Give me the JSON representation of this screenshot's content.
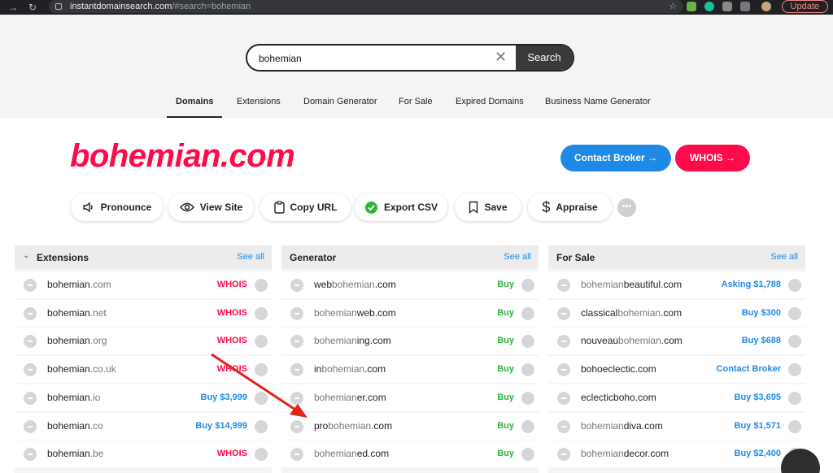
{
  "browser": {
    "url_host": "instantdomainsearch.com",
    "url_path": "/#search=bohemian",
    "update_label": "Update"
  },
  "search": {
    "value": "bohemian",
    "button_label": "Search"
  },
  "tabs": [
    {
      "label": "Domains",
      "active": true
    },
    {
      "label": "Extensions"
    },
    {
      "label": "Domain Generator"
    },
    {
      "label": "For Sale"
    },
    {
      "label": "Expired Domains"
    },
    {
      "label": "Business Name Generator"
    }
  ],
  "domain_title": "bohemian.com",
  "buttons": {
    "contact_broker": "Contact Broker →",
    "whois": "WHOIS →"
  },
  "actions": [
    {
      "label": "Pronounce",
      "icon": "speaker-icon"
    },
    {
      "label": "View Site",
      "icon": "eye-icon"
    },
    {
      "label": "Copy URL",
      "icon": "clipboard-icon"
    },
    {
      "label": "Export CSV",
      "icon": "check-badge-icon"
    },
    {
      "label": "Save",
      "icon": "bookmark-icon"
    },
    {
      "label": "Appraise",
      "icon": "dollar-icon"
    }
  ],
  "see_all_label": "See all",
  "panels": {
    "extensions": {
      "title": "Extensions",
      "rows": [
        {
          "name": "bohemian",
          "ext": ".com",
          "action": "WHOIS"
        },
        {
          "name": "bohemian",
          "ext": ".net",
          "action": "WHOIS"
        },
        {
          "name": "bohemian",
          "ext": ".org",
          "action": "WHOIS"
        },
        {
          "name": "bohemian",
          "ext": ".co.uk",
          "action": "WHOIS"
        },
        {
          "name": "bohemian",
          "ext": ".io",
          "action": "Buy $3,999"
        },
        {
          "name": "bohemian",
          "ext": ".co",
          "action": "Buy $14,999"
        },
        {
          "name": "bohemian",
          "ext": ".be",
          "action": "WHOIS"
        }
      ]
    },
    "generator": {
      "title": "Generator",
      "rows": [
        {
          "pre": "web",
          "main": "bohemian",
          "post": ".com",
          "action": "Buy"
        },
        {
          "pre": "",
          "main": "bohemian",
          "post": "web.com",
          "action": "Buy"
        },
        {
          "pre": "",
          "main": "bohemian",
          "post": "ing.com",
          "action": "Buy"
        },
        {
          "pre": "in",
          "main": "bohemian",
          "post": ".com",
          "action": "Buy"
        },
        {
          "pre": "",
          "main": "bohemian",
          "post": "er.com",
          "action": "Buy"
        },
        {
          "pre": "pro",
          "main": "bohemian",
          "post": ".com",
          "action": "Buy"
        },
        {
          "pre": "",
          "main": "bohemian",
          "post": "ed.com",
          "action": "Buy"
        }
      ]
    },
    "for_sale": {
      "title": "For Sale",
      "rows": [
        {
          "pre": "",
          "main": "bohemian",
          "post": "beautiful.com",
          "action": "Asking $1,788"
        },
        {
          "pre": "classical",
          "main": "bohemian",
          "post": ".com",
          "action": "Buy $300"
        },
        {
          "pre": "nouveau",
          "main": "bohemian",
          "post": ".com",
          "action": "Buy $688"
        },
        {
          "pre": "",
          "main": "",
          "post": "bohoeclectic.com",
          "action": "Contact Broker"
        },
        {
          "pre": "",
          "main": "",
          "post": "eclecticboho.com",
          "action": "Buy $3,695"
        },
        {
          "pre": "",
          "main": "bohemian",
          "post": "diva.com",
          "action": "Buy $1,571"
        },
        {
          "pre": "",
          "main": "bohemian",
          "post": "decor.com",
          "action": "Buy $2,400"
        }
      ]
    }
  },
  "colors": {
    "brand_red": "#ff0a4a",
    "brand_blue": "#1f8ae6",
    "buy_green": "#2db53b",
    "annotation_arrow": "#e8201a"
  }
}
